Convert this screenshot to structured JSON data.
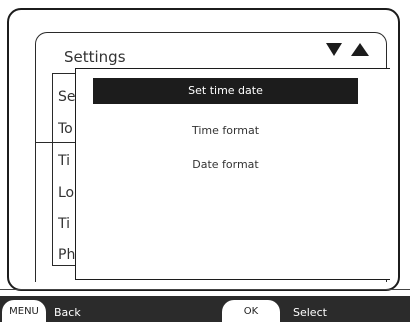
{
  "settings": {
    "title": "Settings",
    "list_items": [
      "Se",
      "To",
      "Ti",
      "Lo",
      "Ti",
      "Ph"
    ]
  },
  "popup": {
    "items": [
      "Set time date",
      "Time format",
      "Date format"
    ],
    "selected_index": 0
  },
  "softkeys": {
    "left_key": "MENU",
    "left_label": "Back",
    "right_key": "OK",
    "right_label": "Select"
  },
  "icons": {
    "down_arrow": "triangle-down-icon",
    "up_arrow": "triangle-up-icon"
  },
  "colors": {
    "selection": "#1c1c1c",
    "bar": "#2b2b2b"
  }
}
